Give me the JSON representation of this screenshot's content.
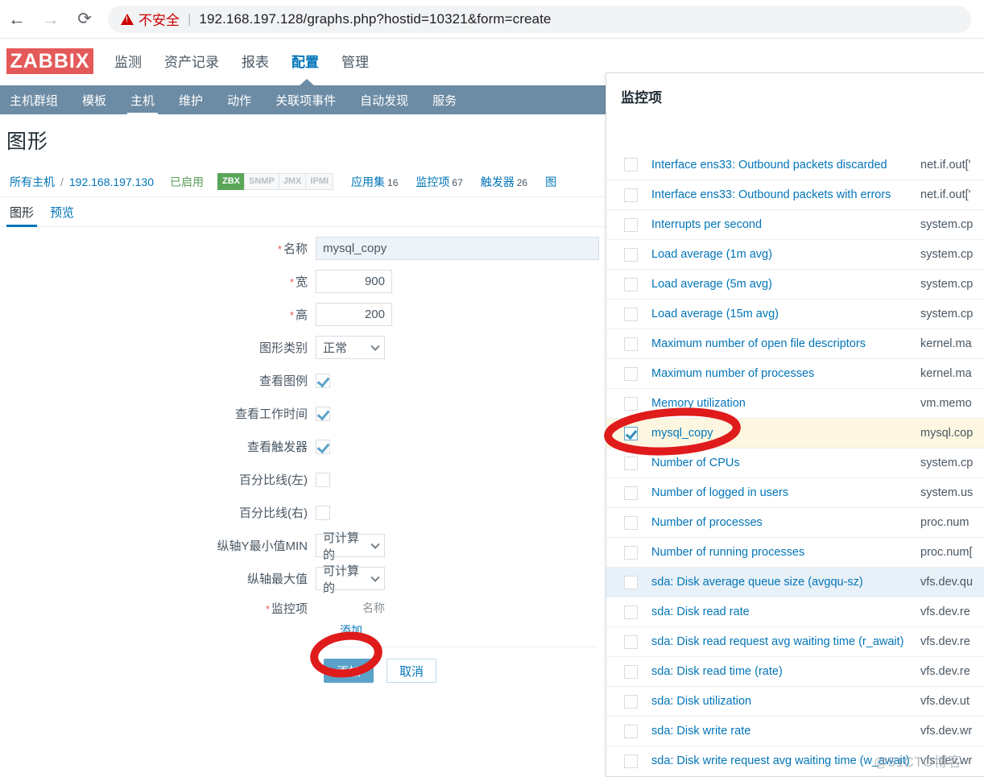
{
  "browser": {
    "back_icon": "arrow-left-icon",
    "forward_icon": "arrow-right-icon",
    "reload_icon": "reload-icon",
    "security_warning": "不安全",
    "url": "192.168.197.128/graphs.php?hostid=10321&form=create"
  },
  "app": {
    "logo": "ZABBIX",
    "top_menu": [
      {
        "label": "监测",
        "active": false
      },
      {
        "label": "资产记录",
        "active": false
      },
      {
        "label": "报表",
        "active": false
      },
      {
        "label": "配置",
        "active": true
      },
      {
        "label": "管理",
        "active": false
      }
    ],
    "sub_menu": [
      {
        "label": "主机群组",
        "active": false
      },
      {
        "label": "模板",
        "active": false
      },
      {
        "label": "主机",
        "active": true
      },
      {
        "label": "维护",
        "active": false
      },
      {
        "label": "动作",
        "active": false
      },
      {
        "label": "关联项事件",
        "active": false
      },
      {
        "label": "自动发现",
        "active": false
      },
      {
        "label": "服务",
        "active": false
      }
    ]
  },
  "page": {
    "title": "图形"
  },
  "breadcrumb": {
    "all_hosts": "所有主机",
    "separator": "/",
    "host": "192.168.197.130",
    "status": "已启用",
    "protocols": [
      {
        "label": "ZBX",
        "enabled": true
      },
      {
        "label": "SNMP",
        "enabled": false
      },
      {
        "label": "JMX",
        "enabled": false
      },
      {
        "label": "IPMI",
        "enabled": false
      }
    ],
    "counts": [
      {
        "label": "应用集",
        "count": "16"
      },
      {
        "label": "监控项",
        "count": "67"
      },
      {
        "label": "触发器",
        "count": "26"
      },
      {
        "label": "图",
        "count": ""
      }
    ]
  },
  "tabs": [
    {
      "label": "图形",
      "active": true
    },
    {
      "label": "预览",
      "active": false
    }
  ],
  "form": {
    "name": {
      "label": "名称",
      "required": true,
      "value": "mysql_copy"
    },
    "width": {
      "label": "宽",
      "required": true,
      "value": "900"
    },
    "height": {
      "label": "高",
      "required": true,
      "value": "200"
    },
    "graph_type": {
      "label": "图形类别",
      "required": false,
      "value": "正常"
    },
    "show_legend": {
      "label": "查看图例",
      "checked": true
    },
    "show_working_time": {
      "label": "查看工作时间",
      "checked": true
    },
    "show_triggers": {
      "label": "查看触发器",
      "checked": true
    },
    "percentile_left": {
      "label": "百分比线(左)",
      "checked": false
    },
    "percentile_right": {
      "label": "百分比线(右)",
      "checked": false
    },
    "y_min": {
      "label": "纵轴Y最小值MIN",
      "value": "可计算的"
    },
    "y_max": {
      "label": "纵轴最大值",
      "value": "可计算的"
    },
    "items": {
      "label": "监控项",
      "required": true,
      "column_header": "名称",
      "add_link": "添加"
    },
    "buttons": {
      "submit": "添加",
      "cancel": "取消"
    }
  },
  "popup": {
    "title": "监控项",
    "rows": [
      {
        "name": "Interface ens33: Outbound packets discarded",
        "key": "net.if.out['",
        "checked": false,
        "state": "normal"
      },
      {
        "name": "Interface ens33: Outbound packets with errors",
        "key": "net.if.out['",
        "checked": false,
        "state": "normal"
      },
      {
        "name": "Interrupts per second",
        "key": "system.cp",
        "checked": false,
        "state": "normal"
      },
      {
        "name": "Load average (1m avg)",
        "key": "system.cp",
        "checked": false,
        "state": "normal"
      },
      {
        "name": "Load average (5m avg)",
        "key": "system.cp",
        "checked": false,
        "state": "normal"
      },
      {
        "name": "Load average (15m avg)",
        "key": "system.cp",
        "checked": false,
        "state": "normal"
      },
      {
        "name": "Maximum number of open file descriptors",
        "key": "kernel.ma",
        "checked": false,
        "state": "normal"
      },
      {
        "name": "Maximum number of processes",
        "key": "kernel.ma",
        "checked": false,
        "state": "normal"
      },
      {
        "name": "Memory utilization",
        "key": "vm.memo",
        "checked": false,
        "state": "normal"
      },
      {
        "name": "mysql_copy",
        "key": "mysql.cop",
        "checked": true,
        "state": "selected"
      },
      {
        "name": "Number of CPUs",
        "key": "system.cp",
        "checked": false,
        "state": "normal"
      },
      {
        "name": "Number of logged in users",
        "key": "system.us",
        "checked": false,
        "state": "normal"
      },
      {
        "name": "Number of processes",
        "key": "proc.num",
        "checked": false,
        "state": "normal"
      },
      {
        "name": "Number of running processes",
        "key": "proc.num[",
        "checked": false,
        "state": "normal"
      },
      {
        "name": "sda: Disk average queue size (avgqu-sz)",
        "key": "vfs.dev.qu",
        "checked": false,
        "state": "hover"
      },
      {
        "name": "sda: Disk read rate",
        "key": "vfs.dev.re",
        "checked": false,
        "state": "normal"
      },
      {
        "name": "sda: Disk read request avg waiting time (r_await)",
        "key": "vfs.dev.re",
        "checked": false,
        "state": "normal"
      },
      {
        "name": "sda: Disk read time (rate)",
        "key": "vfs.dev.re",
        "checked": false,
        "state": "normal"
      },
      {
        "name": "sda: Disk utilization",
        "key": "vfs.dev.ut",
        "checked": false,
        "state": "normal"
      },
      {
        "name": "sda: Disk write rate",
        "key": "vfs.dev.wr",
        "checked": false,
        "state": "normal"
      },
      {
        "name": "sda: Disk write request avg waiting time (w_await)",
        "key": "vfs.dev.wr",
        "checked": false,
        "state": "normal"
      }
    ]
  },
  "watermark": "@51CTO博客",
  "colors": {
    "brand_red": "#e45959",
    "subnav_blue": "#6c8ba4",
    "link_blue": "#0275b8",
    "selected_row": "#fdf7e1",
    "hover_row": "#e8f1f8",
    "annotation_red": "#e01b1b"
  }
}
